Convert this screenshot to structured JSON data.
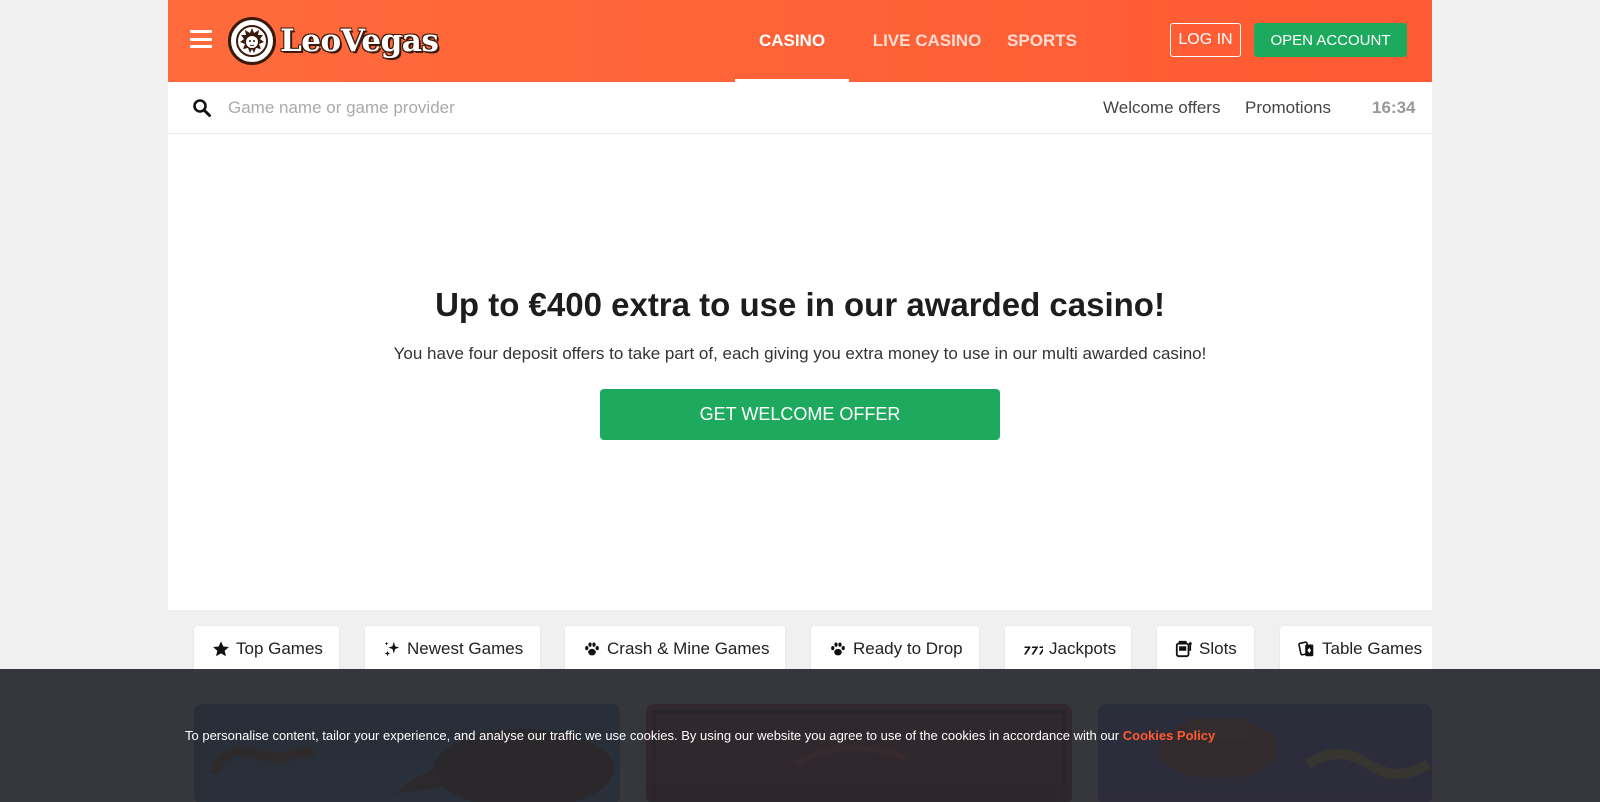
{
  "header": {
    "logo_text": "LeoVegas",
    "nav": [
      {
        "label": "CASINO",
        "active": true
      },
      {
        "label": "LIVE CASINO",
        "active": false
      },
      {
        "label": "SPORTS",
        "active": false
      }
    ],
    "login_label": "LOG IN",
    "open_account_label": "OPEN ACCOUNT",
    "brand_color": "#ff5a33",
    "accent_green": "#1daa5e"
  },
  "search": {
    "placeholder": "Game name or game provider",
    "links": [
      "Welcome offers",
      "Promotions"
    ],
    "time": "16:34"
  },
  "hero": {
    "title": "Up to €400 extra to use in our awarded casino!",
    "subtitle": "You have four deposit offers to take part of, each giving you extra money to use in our multi awarded casino!",
    "cta_label": "GET WELCOME OFFER"
  },
  "categories": [
    {
      "label": "Top Games",
      "icon": "star-icon"
    },
    {
      "label": "Newest Games",
      "icon": "sparkles-icon"
    },
    {
      "label": "Crash & Mine Games",
      "icon": "paw-icon"
    },
    {
      "label": "Ready to Drop",
      "icon": "paw-icon"
    },
    {
      "label": "Jackpots",
      "icon": "sevens-icon"
    },
    {
      "label": "Slots",
      "icon": "slot-machine-icon"
    },
    {
      "label": "Table Games",
      "icon": "cards-icon"
    }
  ],
  "cookie": {
    "text": "To personalise content, tailor your experience, and analyse our traffic we use cookies. By using our website you agree to use of the cookies in accordance with our ",
    "link_label": "Cookies Policy"
  }
}
